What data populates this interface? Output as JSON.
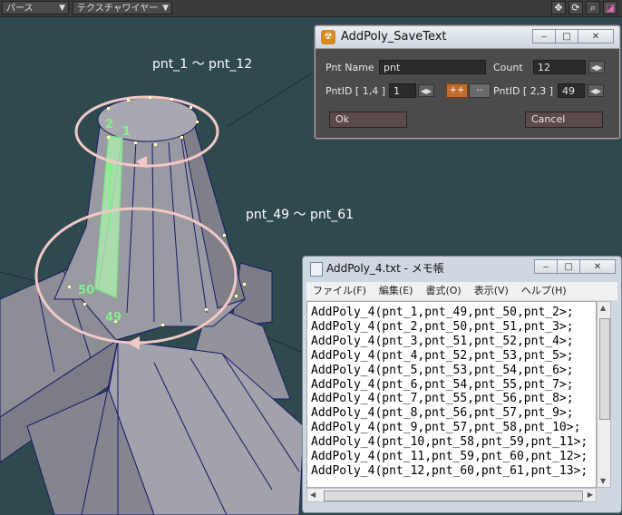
{
  "viewport": {
    "view_dropdown": "パース",
    "shading_dropdown": "テクスチャワイヤー",
    "annotations": {
      "top_ring": "pnt_1 ～ pnt_12",
      "bottom_ring": "pnt_49 ～ pnt_61",
      "label_1": "1",
      "label_2": "2",
      "label_49": "49",
      "label_50": "50"
    },
    "icons": [
      "move-icon",
      "rotate-icon",
      "zoom-icon",
      "frame-icon"
    ]
  },
  "dialog": {
    "title": "AddPoly_SaveText",
    "pnt_name_label": "Pnt Name",
    "pnt_name_value": "pnt",
    "count_label": "Count",
    "count_value": "12",
    "pntid1_label": "PntID [ 1,4 ]",
    "pntid1_value": "1",
    "inc_button": "++",
    "dec_button": "--",
    "pntid2_label": "PntID [ 2,3 ]",
    "pntid2_value": "49",
    "ok_button": "Ok",
    "cancel_button": "Cancel"
  },
  "notepad": {
    "title": "AddPoly_4.txt - メモ帳",
    "menu": [
      "ファイル(F)",
      "編集(E)",
      "書式(O)",
      "表示(V)",
      "ヘルプ(H)"
    ],
    "lines": [
      "AddPoly_4(pnt_1,pnt_49,pnt_50,pnt_2>;",
      "AddPoly_4(pnt_2,pnt_50,pnt_51,pnt_3>;",
      "AddPoly_4(pnt_3,pnt_51,pnt_52,pnt_4>;",
      "AddPoly_4(pnt_4,pnt_52,pnt_53,pnt_5>;",
      "AddPoly_4(pnt_5,pnt_53,pnt_54,pnt_6>;",
      "AddPoly_4(pnt_6,pnt_54,pnt_55,pnt_7>;",
      "AddPoly_4(pnt_7,pnt_55,pnt_56,pnt_8>;",
      "AddPoly_4(pnt_8,pnt_56,pnt_57,pnt_9>;",
      "AddPoly_4(pnt_9,pnt_57,pnt_58,pnt_10>;",
      "AddPoly_4(pnt_10,pnt_58,pnt_59,pnt_11>;",
      "AddPoly_4(pnt_11,pnt_59,pnt_60,pnt_12>;",
      "AddPoly_4(pnt_12,pnt_60,pnt_61,pnt_13>;"
    ]
  },
  "colors": {
    "viewport_bg": "#2f4a4f",
    "mesh_face": "#9a9aa2",
    "mesh_wire": "#1a1a6a",
    "selected_face": "#aee8b0",
    "ring": "#f2c8c6",
    "accent_orange": "#c06a2b",
    "annotation_text": "#ffffff",
    "label_green": "#7ff28a"
  }
}
